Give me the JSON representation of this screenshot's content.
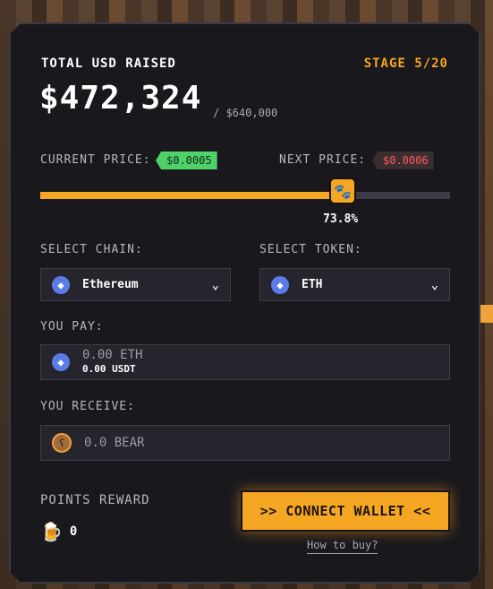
{
  "header": {
    "title": "TOTAL USD RAISED",
    "stage": "STAGE 5/20",
    "raised": "$472,324",
    "goal": "/ $640,000"
  },
  "prices": {
    "current_label": "CURRENT PRICE:",
    "current_value": "$0.0005",
    "current_color": "#4fd169",
    "next_label": "NEXT PRICE:",
    "next_value": "$0.0006",
    "next_color": "#ff5a5a"
  },
  "progress": {
    "percent": 73.8,
    "percent_label": "73.8%",
    "icon": "paw-icon"
  },
  "chain": {
    "label": "SELECT CHAIN:",
    "selected": "Ethereum",
    "icon": "ethereum-icon"
  },
  "token": {
    "label": "SELECT TOKEN:",
    "selected": "ETH",
    "icon": "ethereum-icon"
  },
  "pay": {
    "label": "YOU PAY:",
    "amount": "0.00 ETH",
    "usdt": "0.00 USDT"
  },
  "receive": {
    "label": "YOU RECEIVE:",
    "amount": "0.0 BEAR",
    "icon": "bear-icon"
  },
  "points": {
    "label": "POINTS REWARD",
    "value": "0",
    "icon": "beer-mug-icon"
  },
  "actions": {
    "connect_label": ">> CONNECT WALLET <<",
    "howto_label": "How to buy?"
  },
  "colors": {
    "accent": "#f5a623",
    "panel": "#19181d"
  }
}
